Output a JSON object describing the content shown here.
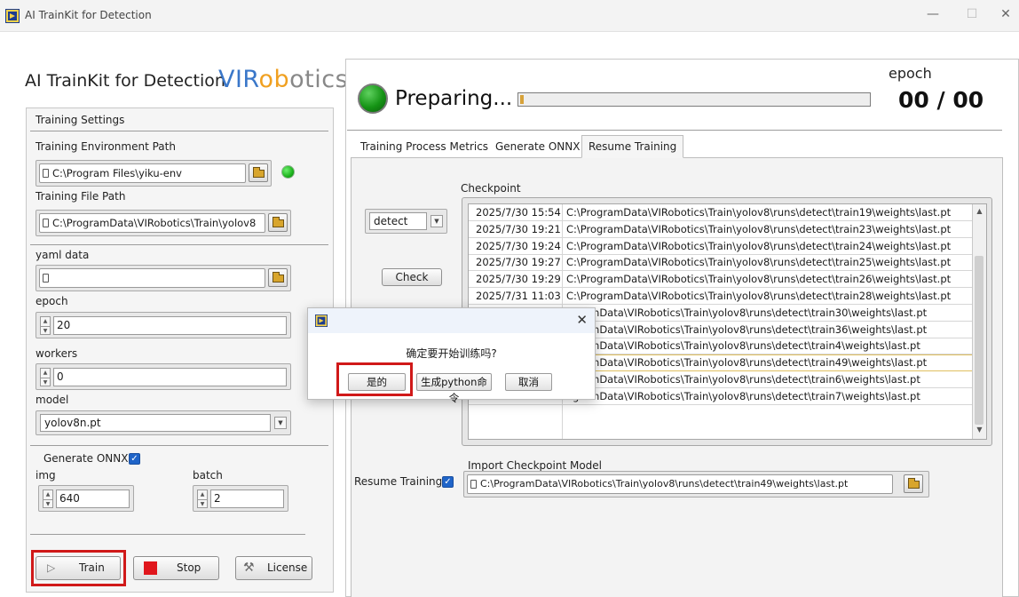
{
  "window": {
    "title": "AI TrainKit for Detection",
    "controls": [
      "—",
      "☐",
      "✕"
    ]
  },
  "header": {
    "app_title": "AI TrainKit for Detection",
    "brand": [
      "VIR",
      "ob",
      "otics"
    ]
  },
  "settings": {
    "group_label": "Training Settings",
    "env_path_label": "Training Environment Path",
    "env_path_value": "C:\\Program Files\\yiku-env",
    "file_path_label": "Training File Path",
    "file_path_value": "C:\\ProgramData\\VIRobotics\\Train\\yolov8",
    "yaml_label": "yaml data",
    "yaml_value": "",
    "epoch_label": "epoch",
    "epoch_value": "20",
    "workers_label": "workers",
    "workers_value": "0",
    "model_label": "model",
    "model_value": "yolov8n.pt",
    "onnx_label": "Generate ONNX",
    "onnx_checked": true,
    "img_label": "img",
    "img_value": "640",
    "batch_label": "batch",
    "batch_value": "2"
  },
  "buttons": {
    "train": "Train",
    "stop": "Stop",
    "license": "License"
  },
  "status": {
    "text": "Preparing...",
    "progress": 0,
    "epoch_label": "epoch",
    "epoch_value": "00 / 00"
  },
  "tabs": [
    {
      "label": "Training Process Metrics",
      "active": false
    },
    {
      "label": "Generate ONNX",
      "active": false
    },
    {
      "label": "Resume Training",
      "active": true
    }
  ],
  "resume": {
    "task_value": "detect",
    "check_button": "Check",
    "checkpoint_label": "Checkpoint",
    "rows": [
      {
        "date": "2025/7/30 15:54",
        "path": "C:\\ProgramData\\VIRobotics\\Train\\yolov8\\runs\\detect\\train19\\weights\\last.pt"
      },
      {
        "date": "2025/7/30 19:21",
        "path": "C:\\ProgramData\\VIRobotics\\Train\\yolov8\\runs\\detect\\train23\\weights\\last.pt"
      },
      {
        "date": "2025/7/30 19:24",
        "path": "C:\\ProgramData\\VIRobotics\\Train\\yolov8\\runs\\detect\\train24\\weights\\last.pt"
      },
      {
        "date": "2025/7/30 19:27",
        "path": "C:\\ProgramData\\VIRobotics\\Train\\yolov8\\runs\\detect\\train25\\weights\\last.pt"
      },
      {
        "date": "2025/7/30 19:29",
        "path": "C:\\ProgramData\\VIRobotics\\Train\\yolov8\\runs\\detect\\train26\\weights\\last.pt"
      },
      {
        "date": "2025/7/31 11:03",
        "path": "C:\\ProgramData\\VIRobotics\\Train\\yolov8\\runs\\detect\\train28\\weights\\last.pt"
      },
      {
        "date": "",
        "path": "ogramData\\VIRobotics\\Train\\yolov8\\runs\\detect\\train30\\weights\\last.pt"
      },
      {
        "date": "",
        "path": "ogramData\\VIRobotics\\Train\\yolov8\\runs\\detect\\train36\\weights\\last.pt"
      },
      {
        "date": "",
        "path": "ogramData\\VIRobotics\\Train\\yolov8\\runs\\detect\\train4\\weights\\last.pt"
      },
      {
        "date": "",
        "path": "ogramData\\VIRobotics\\Train\\yolov8\\runs\\detect\\train49\\weights\\last.pt"
      },
      {
        "date": "",
        "path": "ogramData\\VIRobotics\\Train\\yolov8\\runs\\detect\\train6\\weights\\last.pt"
      },
      {
        "date": "",
        "path": "ogramData\\VIRobotics\\Train\\yolov8\\runs\\detect\\train7\\weights\\last.pt"
      }
    ],
    "resume_label": "Resume Training",
    "resume_checked": true,
    "import_label": "Import Checkpoint Model",
    "import_value": "C:\\ProgramData\\VIRobotics\\Train\\yolov8\\runs\\detect\\train49\\weights\\last.pt"
  },
  "dialog": {
    "message": "确定要开始训练吗?",
    "yes": "是的",
    "python": "生成python命令",
    "cancel": "取消",
    "close": "✕"
  },
  "colors": {
    "led_green": "#1db31d",
    "highlight_red": "#d01919",
    "check_blue": "#1f64c8",
    "brand_blue": "#3a77c9",
    "brand_orange": "#f0a020"
  }
}
